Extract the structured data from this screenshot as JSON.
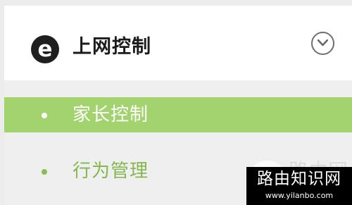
{
  "menu": {
    "title": "上网控制",
    "header_icon": "e",
    "items": [
      {
        "label": "家长控制",
        "active": true
      },
      {
        "label": "行为管理",
        "active": false
      }
    ]
  },
  "partial_text": "路由网",
  "watermark": {
    "title": "路由知识网",
    "url": "www.yilanbo.com"
  },
  "colors": {
    "background": "#ececec",
    "header_background": "#ffffff",
    "active_item_background": "#a3d36e",
    "active_item_text": "#ffffff",
    "inactive_item_text": "#86b74e",
    "title_text": "#1b1b1b",
    "icon_background": "#1f1f1f",
    "watermark_background": "#000000"
  },
  "icons": {
    "header_icon": "ie-logo-icon",
    "toggle_icon": "chevron-down-circle-icon",
    "bullet_icon": "dot-icon"
  }
}
